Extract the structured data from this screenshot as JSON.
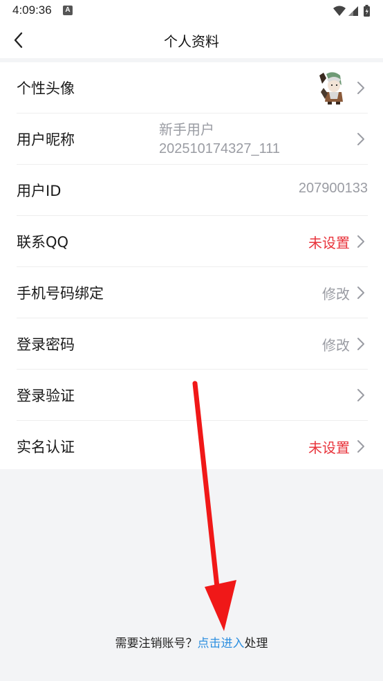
{
  "status_bar": {
    "time": "4:09:36",
    "badge": "A",
    "icons": [
      "wifi-icon",
      "signal-icon",
      "battery-icon"
    ]
  },
  "header": {
    "title": "个人资料"
  },
  "rows": [
    {
      "label": "个性头像",
      "value": "",
      "icon": "avatar-image"
    },
    {
      "label": "用户昵称",
      "value_line1": "新手用户",
      "value_line2": "202510174327_111"
    },
    {
      "label": "用户ID",
      "value": "207900133"
    },
    {
      "label": "联系QQ",
      "value": "未设置"
    },
    {
      "label": "手机号码绑定",
      "value": "修改"
    },
    {
      "label": "登录密码",
      "value": "修改"
    },
    {
      "label": "登录验证",
      "value": ""
    },
    {
      "label": "实名认证",
      "value": "未设置"
    }
  ],
  "footer": {
    "prefix": "需要注销账号？",
    "link": "点击进入",
    "suffix": "处理"
  },
  "colors": {
    "accent_red": "#e8343c",
    "link_blue": "#2d8fe0",
    "muted": "#9a9ca3",
    "annotation_arrow": "#f01818"
  }
}
